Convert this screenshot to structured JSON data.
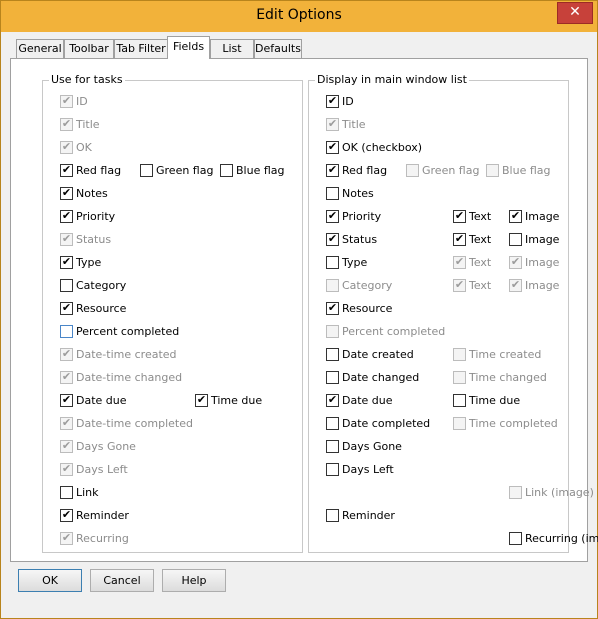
{
  "window": {
    "title": "Edit Options",
    "close_glyph": "✕"
  },
  "tabs": [
    "General",
    "Toolbar",
    "Tab Filter",
    "Fields",
    "List",
    "Defaults"
  ],
  "active_tab": "Fields",
  "left_group": {
    "legend": "Use for tasks",
    "rows": [
      [
        {
          "label": "ID",
          "checked": true,
          "disabled": true
        }
      ],
      [
        {
          "label": "Title",
          "checked": true,
          "disabled": true
        }
      ],
      [
        {
          "label": "OK",
          "checked": true,
          "disabled": true
        }
      ],
      [
        {
          "label": "Red flag",
          "checked": true,
          "disabled": false
        },
        {
          "label": "Green flag",
          "checked": false,
          "disabled": false
        },
        {
          "label": "Blue flag",
          "checked": false,
          "disabled": false
        }
      ],
      [
        {
          "label": "Notes",
          "checked": true,
          "disabled": false
        }
      ],
      [
        {
          "label": "Priority",
          "checked": true,
          "disabled": false
        }
      ],
      [
        {
          "label": "Status",
          "checked": true,
          "disabled": true
        }
      ],
      [
        {
          "label": "Type",
          "checked": true,
          "disabled": false
        }
      ],
      [
        {
          "label": "Category",
          "checked": false,
          "disabled": false
        }
      ],
      [
        {
          "label": "Resource",
          "checked": true,
          "disabled": false
        }
      ],
      [
        {
          "label": "Percent completed",
          "checked": false,
          "disabled": false,
          "focused": true
        }
      ],
      [
        {
          "label": "Date-time created",
          "checked": true,
          "disabled": true
        }
      ],
      [
        {
          "label": "Date-time changed",
          "checked": true,
          "disabled": true
        }
      ],
      [
        {
          "label": "Date due",
          "checked": true,
          "disabled": false
        },
        {
          "label": "Time due",
          "checked": true,
          "disabled": false
        }
      ],
      [
        {
          "label": "Date-time completed",
          "checked": true,
          "disabled": true
        }
      ],
      [
        {
          "label": "Days Gone",
          "checked": true,
          "disabled": true
        }
      ],
      [
        {
          "label": "Days Left",
          "checked": true,
          "disabled": true
        }
      ],
      [
        {
          "label": "Link",
          "checked": false,
          "disabled": false
        }
      ],
      [
        {
          "label": "Reminder",
          "checked": true,
          "disabled": false
        }
      ],
      [
        {
          "label": "Recurring",
          "checked": true,
          "disabled": true
        }
      ]
    ]
  },
  "right_group": {
    "legend": "Display in main window list",
    "rows": [
      [
        {
          "label": "ID",
          "checked": true,
          "disabled": false
        }
      ],
      [
        {
          "label": "Title",
          "checked": true,
          "disabled": true
        }
      ],
      [
        {
          "label": "OK (checkbox)",
          "checked": true,
          "disabled": false
        }
      ],
      [
        {
          "label": "Red flag",
          "checked": true,
          "disabled": false
        },
        {
          "label": "Green flag",
          "checked": false,
          "disabled": true
        },
        {
          "label": "Blue flag",
          "checked": false,
          "disabled": true
        }
      ],
      [
        {
          "label": "Notes",
          "checked": false,
          "disabled": false
        }
      ],
      [
        {
          "label": "Priority",
          "checked": true,
          "disabled": false
        },
        {
          "label": "Text",
          "checked": true,
          "disabled": false
        },
        {
          "label": "Image",
          "checked": true,
          "disabled": false
        }
      ],
      [
        {
          "label": "Status",
          "checked": true,
          "disabled": false
        },
        {
          "label": "Text",
          "checked": true,
          "disabled": false
        },
        {
          "label": "Image",
          "checked": false,
          "disabled": false
        }
      ],
      [
        {
          "label": "Type",
          "checked": false,
          "disabled": false
        },
        {
          "label": "Text",
          "checked": true,
          "disabled": true
        },
        {
          "label": "Image",
          "checked": true,
          "disabled": true
        }
      ],
      [
        {
          "label": "Category",
          "checked": false,
          "disabled": true
        },
        {
          "label": "Text",
          "checked": true,
          "disabled": true
        },
        {
          "label": "Image",
          "checked": true,
          "disabled": true
        }
      ],
      [
        {
          "label": "Resource",
          "checked": true,
          "disabled": false
        }
      ],
      [
        {
          "label": "Percent completed",
          "checked": false,
          "disabled": true
        }
      ],
      [
        {
          "label": "Date created",
          "checked": false,
          "disabled": false
        },
        {
          "label": "Time created",
          "checked": false,
          "disabled": true
        }
      ],
      [
        {
          "label": "Date changed",
          "checked": false,
          "disabled": false
        },
        {
          "label": "Time changed",
          "checked": false,
          "disabled": true
        }
      ],
      [
        {
          "label": "Date due",
          "checked": true,
          "disabled": false
        },
        {
          "label": "Time due",
          "checked": false,
          "disabled": false
        }
      ],
      [
        {
          "label": "Date completed",
          "checked": false,
          "disabled": false
        },
        {
          "label": "Time completed",
          "checked": false,
          "disabled": true
        }
      ],
      [
        {
          "label": "Days Gone",
          "checked": false,
          "disabled": false
        }
      ],
      [
        {
          "label": "Days Left",
          "checked": false,
          "disabled": false
        }
      ],
      [
        {
          "label": "Link (image)",
          "checked": false,
          "disabled": true
        }
      ],
      [
        {
          "label": "Reminder",
          "checked": false,
          "disabled": false
        }
      ],
      [
        {
          "label": "Recurring (image)",
          "checked": false,
          "disabled": false
        }
      ]
    ]
  },
  "buttons": {
    "ok": "OK",
    "cancel": "Cancel",
    "help": "Help"
  },
  "check_glyph": "✔",
  "colors": {
    "titlebar": "#f2b23a",
    "close_button": "#c7413a"
  }
}
